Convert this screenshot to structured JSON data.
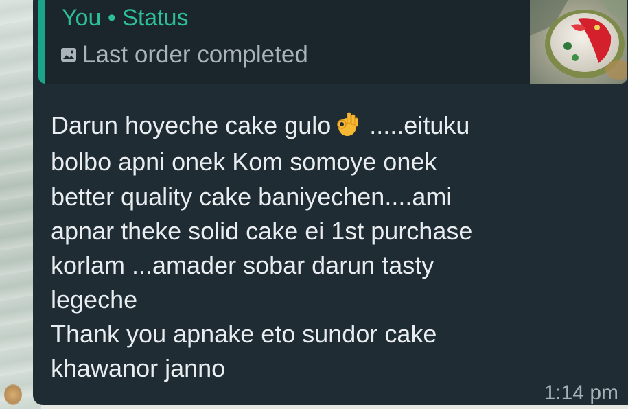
{
  "quote": {
    "author": "You",
    "separator": " • ",
    "context": "Status",
    "caption": "Last order completed",
    "caption_icon": "photo-icon",
    "thumbnail": "status-cake-thumbnail"
  },
  "message": {
    "line1_before_emoji": "Darun hoyeche cake gulo",
    "emoji": "ok-hand-emoji",
    "line1_after_emoji": " .....eituku",
    "line2": "bolbo apni onek Kom somoye onek",
    "line3": "better quality cake  baniyechen....ami",
    "line4": "apnar theke solid cake ei 1st purchase",
    "line5": "korlam ...amader sobar darun tasty",
    "line6": "legeche",
    "line7": "Thank you apnake eto sundor cake",
    "line8": "khawanor janno",
    "time": "1:14 pm"
  },
  "colors": {
    "bubble_bg": "#1f2c34",
    "quote_bg": "#1a252c",
    "quote_accent": "#1aa588",
    "author_text": "#2dbe96",
    "body_text": "#e9edef",
    "meta_text": "#a7b1b6"
  }
}
